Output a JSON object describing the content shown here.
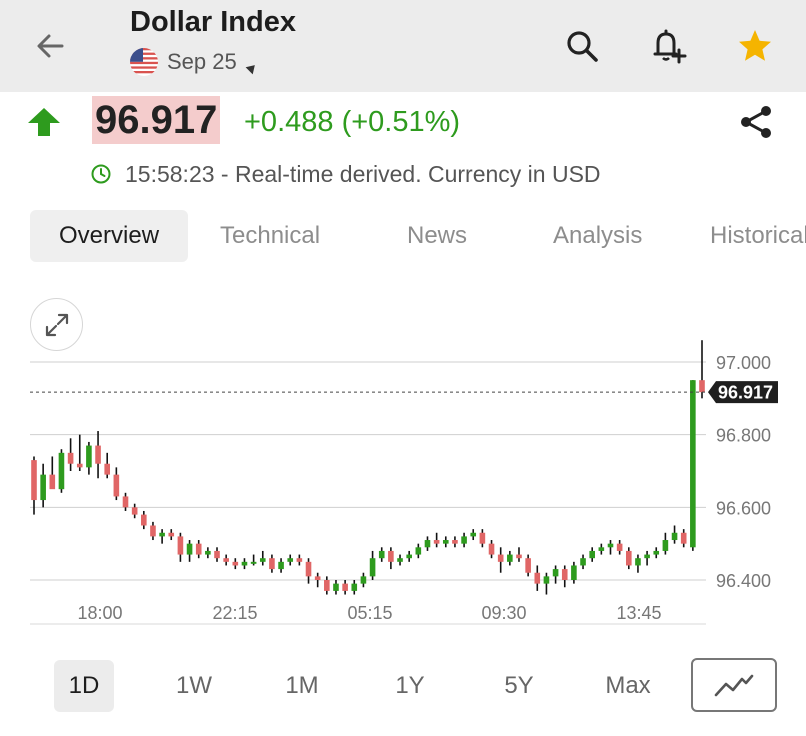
{
  "header": {
    "title": "Dollar Index",
    "expiry": "Sep 25"
  },
  "quote": {
    "price": "96.917",
    "change": "+0.488 (+0.51%)",
    "status": "15:58:23 - Real-time derived. Currency in USD"
  },
  "tabs": [
    {
      "label": "Overview",
      "active": true
    },
    {
      "label": "Technical"
    },
    {
      "label": "News"
    },
    {
      "label": "Analysis"
    },
    {
      "label": "Historical"
    }
  ],
  "ranges": [
    {
      "label": "1D",
      "active": true
    },
    {
      "label": "1W"
    },
    {
      "label": "1M"
    },
    {
      "label": "1Y"
    },
    {
      "label": "5Y"
    },
    {
      "label": "Max"
    }
  ],
  "colors": {
    "up": "#2e9b1e",
    "down": "#e06666",
    "accent_star": "#f5b400",
    "price_highlight": "#f4cccc"
  },
  "icons": {
    "back": "arrow-left-icon",
    "search": "search-icon",
    "alert": "bell-plus-icon",
    "watchlist": "star-icon",
    "share": "share-icon",
    "clock": "clock-icon",
    "expand": "expand-icon",
    "chart_type": "line-chart-icon"
  },
  "chart_data": {
    "type": "candlestick",
    "x_tick_labels": [
      "18:00",
      "22:15",
      "05:15",
      "09:30",
      "13:45"
    ],
    "y_tick_labels": [
      "97.000",
      "96.800",
      "96.600",
      "96.400"
    ],
    "ylim": [
      96.35,
      97.05
    ],
    "last_price_label": "96.917",
    "last_price": 96.917,
    "grid": true,
    "candles": [
      [
        96.73,
        96.74,
        96.58,
        96.62
      ],
      [
        96.62,
        96.72,
        96.6,
        96.69
      ],
      [
        96.69,
        96.74,
        96.66,
        96.65
      ],
      [
        96.65,
        96.76,
        96.64,
        96.75
      ],
      [
        96.75,
        96.79,
        96.7,
        96.72
      ],
      [
        96.72,
        96.8,
        96.7,
        96.71
      ],
      [
        96.71,
        96.78,
        96.69,
        96.77
      ],
      [
        96.77,
        96.81,
        96.68,
        96.72
      ],
      [
        96.72,
        96.75,
        96.68,
        96.69
      ],
      [
        96.69,
        96.71,
        96.62,
        96.63
      ],
      [
        96.63,
        96.64,
        96.59,
        96.6
      ],
      [
        96.6,
        96.61,
        96.57,
        96.58
      ],
      [
        96.58,
        96.59,
        96.54,
        96.55
      ],
      [
        96.55,
        96.56,
        96.51,
        96.52
      ],
      [
        96.52,
        96.54,
        96.5,
        96.53
      ],
      [
        96.53,
        96.54,
        96.51,
        96.52
      ],
      [
        96.52,
        96.53,
        96.45,
        96.47
      ],
      [
        96.47,
        96.51,
        96.45,
        96.5
      ],
      [
        96.5,
        96.51,
        96.46,
        96.47
      ],
      [
        96.47,
        96.49,
        96.46,
        96.48
      ],
      [
        96.48,
        96.49,
        96.45,
        96.46
      ],
      [
        96.46,
        96.47,
        96.44,
        96.45
      ],
      [
        96.45,
        96.46,
        96.43,
        96.44
      ],
      [
        96.44,
        96.46,
        96.43,
        96.45
      ],
      [
        96.45,
        96.47,
        96.44,
        96.45
      ],
      [
        96.45,
        96.48,
        96.44,
        96.46
      ],
      [
        96.46,
        96.47,
        96.42,
        96.43
      ],
      [
        96.43,
        96.46,
        96.42,
        96.45
      ],
      [
        96.45,
        96.47,
        96.44,
        96.46
      ],
      [
        96.46,
        96.47,
        96.44,
        96.45
      ],
      [
        96.45,
        96.46,
        96.39,
        96.41
      ],
      [
        96.41,
        96.42,
        96.38,
        96.4
      ],
      [
        96.4,
        96.41,
        96.36,
        96.37
      ],
      [
        96.37,
        96.4,
        96.36,
        96.39
      ],
      [
        96.39,
        96.4,
        96.36,
        96.37
      ],
      [
        96.37,
        96.4,
        96.36,
        96.39
      ],
      [
        96.39,
        96.42,
        96.38,
        96.41
      ],
      [
        96.41,
        96.48,
        96.4,
        96.46
      ],
      [
        96.46,
        96.49,
        96.45,
        96.48
      ],
      [
        96.48,
        96.49,
        96.43,
        96.45
      ],
      [
        96.45,
        96.47,
        96.44,
        96.46
      ],
      [
        96.46,
        96.48,
        96.45,
        96.47
      ],
      [
        96.47,
        96.5,
        96.46,
        96.49
      ],
      [
        96.49,
        96.52,
        96.48,
        96.51
      ],
      [
        96.51,
        96.53,
        96.49,
        96.5
      ],
      [
        96.5,
        96.52,
        96.49,
        96.51
      ],
      [
        96.51,
        96.52,
        96.49,
        96.5
      ],
      [
        96.5,
        96.53,
        96.49,
        96.52
      ],
      [
        96.52,
        96.54,
        96.51,
        96.53
      ],
      [
        96.53,
        96.54,
        96.49,
        96.5
      ],
      [
        96.5,
        96.51,
        96.46,
        96.47
      ],
      [
        96.47,
        96.49,
        96.42,
        96.45
      ],
      [
        96.45,
        96.48,
        96.44,
        96.47
      ],
      [
        96.47,
        96.49,
        96.45,
        96.46
      ],
      [
        96.46,
        96.47,
        96.41,
        96.42
      ],
      [
        96.42,
        96.44,
        96.37,
        96.39
      ],
      [
        96.39,
        96.42,
        96.36,
        96.41
      ],
      [
        96.41,
        96.44,
        96.39,
        96.43
      ],
      [
        96.43,
        96.44,
        96.38,
        96.4
      ],
      [
        96.4,
        96.45,
        96.39,
        96.44
      ],
      [
        96.44,
        96.47,
        96.43,
        96.46
      ],
      [
        96.46,
        96.49,
        96.45,
        96.48
      ],
      [
        96.48,
        96.5,
        96.47,
        96.49
      ],
      [
        96.49,
        96.51,
        96.47,
        96.5
      ],
      [
        96.5,
        96.51,
        96.47,
        96.48
      ],
      [
        96.48,
        96.49,
        96.43,
        96.44
      ],
      [
        96.44,
        96.47,
        96.42,
        96.46
      ],
      [
        96.46,
        96.48,
        96.44,
        96.47
      ],
      [
        96.47,
        96.49,
        96.46,
        96.48
      ],
      [
        96.48,
        96.53,
        96.47,
        96.51
      ],
      [
        96.51,
        96.55,
        96.5,
        96.53
      ],
      [
        96.53,
        96.54,
        96.49,
        96.5
      ],
      [
        96.49,
        96.95,
        96.48,
        96.95
      ],
      [
        96.95,
        97.06,
        96.9,
        96.917
      ]
    ]
  }
}
